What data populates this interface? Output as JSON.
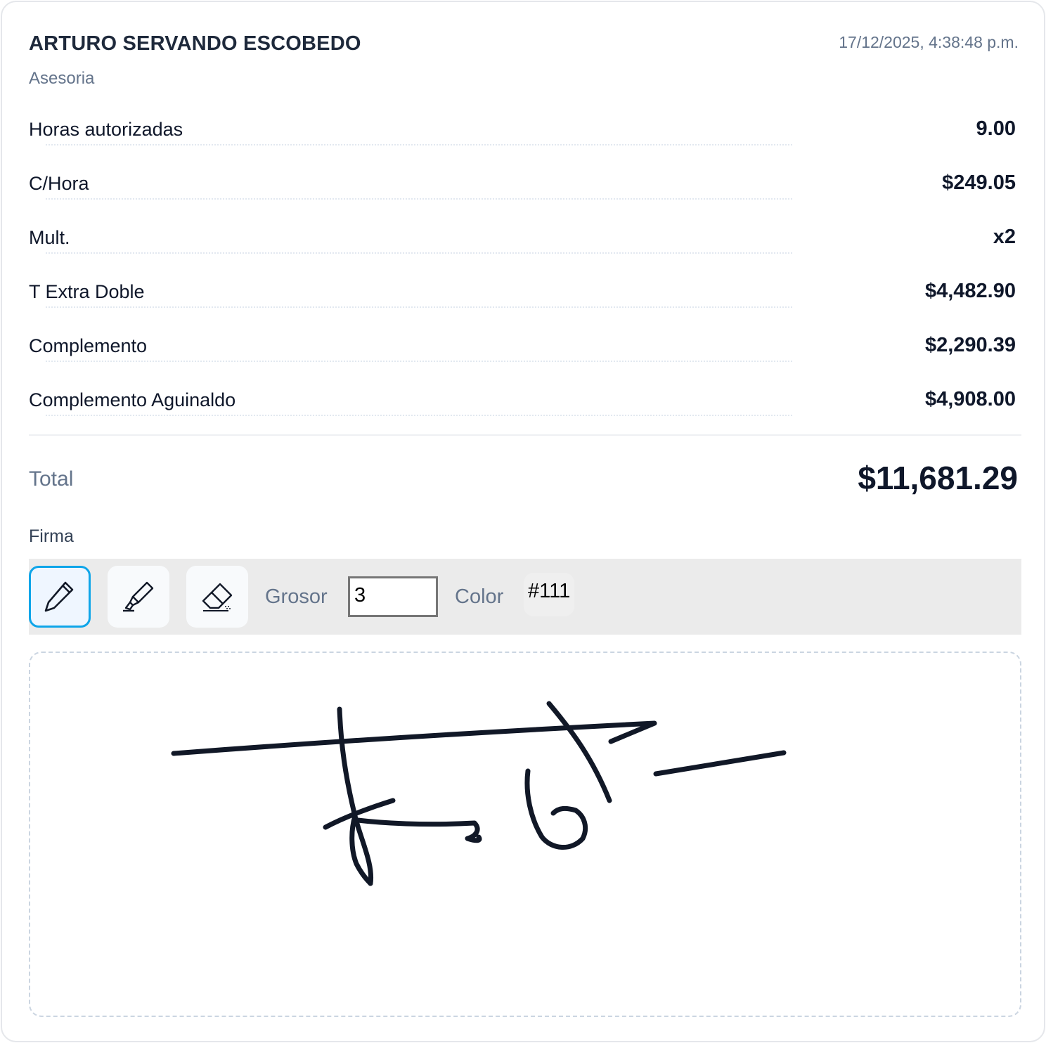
{
  "header": {
    "name": "ARTURO SERVANDO ESCOBEDO",
    "timestamp": "17/12/2025, 4:38:48 p.m.",
    "subtitle": "Asesoria"
  },
  "rows": [
    {
      "label": "Horas autorizadas",
      "value": "9.00"
    },
    {
      "label": "C/Hora",
      "value": "$249.05"
    },
    {
      "label": "Mult.",
      "value": "x2"
    },
    {
      "label": "T Extra Doble",
      "value": "$4,482.90"
    },
    {
      "label": "Complemento",
      "value": "$2,290.39"
    },
    {
      "label": "Complemento Aguinaldo",
      "value": "$4,908.00"
    }
  ],
  "total": {
    "label": "Total",
    "value": "$11,681.29"
  },
  "signature": {
    "label": "Firma",
    "tools": [
      {
        "name": "pen",
        "icon": "pen-icon",
        "active": true
      },
      {
        "name": "marker",
        "icon": "marker-icon",
        "active": false
      },
      {
        "name": "eraser",
        "icon": "eraser-icon",
        "active": false
      }
    ],
    "grosor_label": "Grosor",
    "grosor_value": "3",
    "color_label": "Color",
    "color_value": "#111",
    "stroke_color": "#111827",
    "accent_color": "#0ea5e9"
  }
}
